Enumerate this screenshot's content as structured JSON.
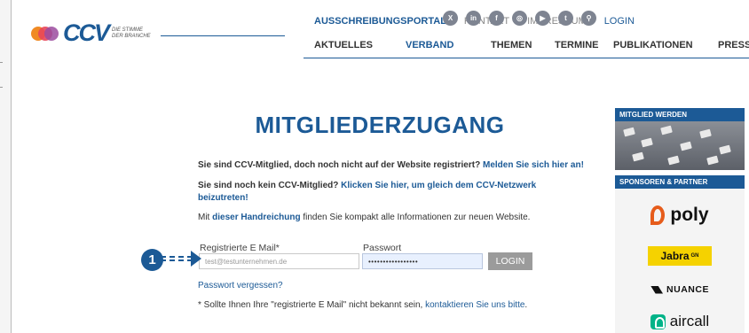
{
  "header": {
    "logo_text": "CCV",
    "tagline_line1": "DIE STIMME",
    "tagline_line2": "DER BRANCHE",
    "topnav": [
      "AUSSCHREIBUNGSPORTAL",
      "KONTAKT",
      "IMPRESSUM",
      "LOGIN"
    ],
    "social_icons": [
      "xing-icon",
      "linkedin-icon",
      "facebook-icon",
      "instagram-icon",
      "youtube-icon",
      "twitter-icon",
      "search-icon"
    ],
    "social_glyphs": [
      "X",
      "in",
      "f",
      "◎",
      "▶",
      "t",
      "⚲"
    ],
    "mainnav": [
      "AKTUELLES",
      "VERBAND",
      "THEMEN",
      "TERMINE",
      "PUBLIKATIONEN",
      "PRESSE"
    ],
    "mainnav_active": "VERBAND"
  },
  "main": {
    "title": "MITGLIEDERZUGANG",
    "line1_text": "Sie sind CCV-Mitglied, doch noch nicht auf der Website registriert?",
    "line1_link": "Melden Sie sich hier an!",
    "line2_text": "Sie sind noch kein CCV-Mitglied?",
    "line2_link_a": "Klicken Sie hier, um gleich dem CCV-Netzwerk",
    "line2_link_b": "beizutreten!",
    "line3_pre": "Mit",
    "line3_link": "dieser Handreichung",
    "line3_post": "finden Sie kompakt alle Informationen zur neuen Website.",
    "email_label": "Registrierte E Mail*",
    "email_value": "test@testunternehmen.de",
    "password_label": "Passwort",
    "password_value": "•••••••••••••••••",
    "login_button": "LOGIN",
    "forgot_link": "Passwort vergessen?",
    "footnote_pre": "* Sollte Ihnen Ihre \"registrierte E Mail\" nicht bekannt sein,",
    "footnote_link": "kontaktieren Sie uns bitte",
    "footnote_post": "."
  },
  "annotation": {
    "step_number": "1"
  },
  "sidebar": {
    "member_header": "MITGLIED WERDEN",
    "sponsor_header": "SPONSOREN & PARTNER",
    "sponsors": {
      "poly": "poly",
      "jabra": "Jabra",
      "jabra_sup": "GN",
      "nuance": "NUANCE",
      "aircall": "aircall"
    }
  },
  "colors": {
    "brand_blue": "#1c5a96",
    "button_gray": "#9b9b9b",
    "jabra_yellow": "#f5d200",
    "aircall_green": "#00b388",
    "poly_orange": "#e65c1b"
  }
}
